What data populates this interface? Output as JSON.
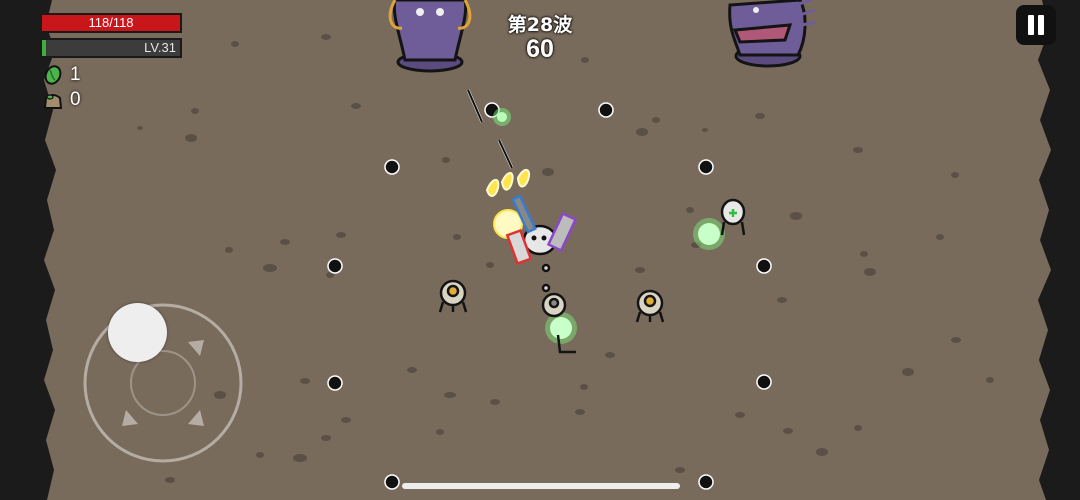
{
  "hud": {
    "hp_text": "118/118",
    "hp_fraction": 1.0,
    "level_text": "LV.31",
    "xp_fraction": 0.03,
    "materials_count": "1",
    "bag_count": "0"
  },
  "wave": {
    "title": "第28波",
    "timer": "60"
  },
  "colors": {
    "ground": "#796b5c",
    "hp": "#c8161b",
    "xp": "#3fae3c",
    "boss": "#6f5d99"
  },
  "icons": [
    "pause-icon",
    "material-icon",
    "bag-icon"
  ]
}
